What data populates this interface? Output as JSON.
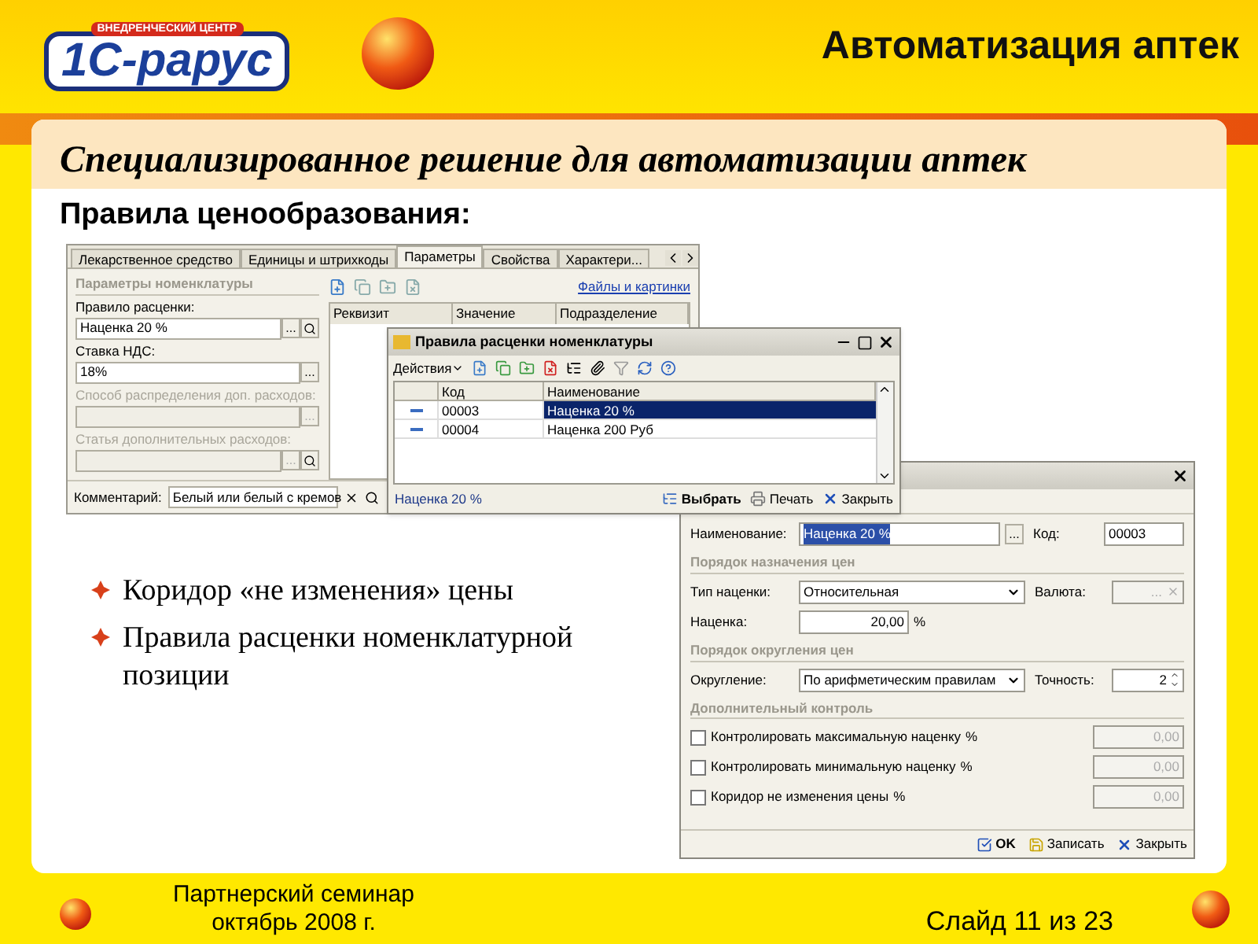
{
  "header": {
    "logo_caption": "ВНЕДРЕНЧЕСКИЙ ЦЕНТР",
    "logo_name": "1С-рарус",
    "title": "Автоматизация аптек"
  },
  "slide": {
    "heading": "Специализированное решение для автоматизации аптек",
    "subheading": "Правила ценообразования:"
  },
  "item_window": {
    "tabs": [
      {
        "label": "Лекарственное средство",
        "selected": false
      },
      {
        "label": "Единицы и штрихкоды",
        "selected": false
      },
      {
        "label": "Параметры",
        "selected": true
      },
      {
        "label": "Свойства",
        "selected": false
      },
      {
        "label": "Характери...",
        "selected": false
      }
    ],
    "group_title": "Параметры номенклатуры",
    "fields": [
      {
        "label": "Правило расценки:",
        "value": "Наценка 20 %",
        "disabled": false,
        "select_label": "...",
        "search": true
      },
      {
        "label": "Ставка НДС:",
        "value": "18%",
        "disabled": false,
        "select_label": "...",
        "search": false
      },
      {
        "label": "Способ распределения доп. расходов:",
        "disabled": true,
        "select_label": "...",
        "search": false
      },
      {
        "label": "Статья дополнительных расходов:",
        "disabled": true,
        "select_label": "...",
        "search": true
      }
    ],
    "files_link": "Файлы и картинки",
    "columns": [
      "Реквизит",
      "Значение",
      "Подразделение"
    ],
    "comment": {
      "label": "Комментарий:",
      "value": "Белый или белый с кремов"
    }
  },
  "rules_window": {
    "title": "Правила расценки номенклатуры",
    "actions_label": "Действия",
    "columns": [
      "Код",
      "Наименование"
    ],
    "rows": [
      {
        "code": "00003",
        "name": "Наценка 20 %",
        "selected": true
      },
      {
        "code": "00004",
        "name": "Наценка 200 Руб",
        "selected": false
      }
    ],
    "status": "Наценка 20 %",
    "buttons": [
      {
        "label": "Выбрать",
        "kind": "select"
      },
      {
        "label": "Печать",
        "kind": "print"
      },
      {
        "label": "Закрыть",
        "kind": "close"
      }
    ]
  },
  "rule_window": {
    "name_label": "Наименование:",
    "name_value": "Наценка 20 %",
    "name_select_label": "...",
    "code_label": "Код:",
    "code_value": "00003",
    "section_1": "Порядок назначения цен",
    "type_label": "Тип наценки:",
    "type_value": "Относительная",
    "currency_label": "Валюта:",
    "currency_select_label": "...",
    "markup_label": "Наценка:",
    "markup_value": "20,00",
    "markup_unit": "%",
    "section_2": "Порядок округления цен",
    "rounding_label": "Округление:",
    "rounding_value": "По арифметическим правилам",
    "precision_label": "Точность:",
    "precision_value": "2",
    "section_3": "Дополнительный контроль",
    "checks": [
      {
        "label": "Контролировать максимальную наценку",
        "unit": "%",
        "value": "0,00",
        "checked": false,
        "disabled": true
      },
      {
        "label": "Контролировать минимальную наценку",
        "unit": "%",
        "value": "0,00",
        "checked": false,
        "disabled": true
      },
      {
        "label": "Коридор не изменения цены",
        "unit": "%",
        "value": "0,00",
        "checked": false,
        "disabled": true
      }
    ],
    "buttons": [
      {
        "label": "OK",
        "kind": "ok"
      },
      {
        "label": "Записать",
        "kind": "save"
      },
      {
        "label": "Закрыть",
        "kind": "close"
      }
    ]
  },
  "bullets": [
    "Коридор «не изменения» цены",
    "Правила расценки номенклатурной позиции"
  ],
  "footer": {
    "seminar": [
      "Партнерский семинар",
      "октябрь 2008 г."
    ],
    "slide_number": "Слайд 11 из 23"
  }
}
